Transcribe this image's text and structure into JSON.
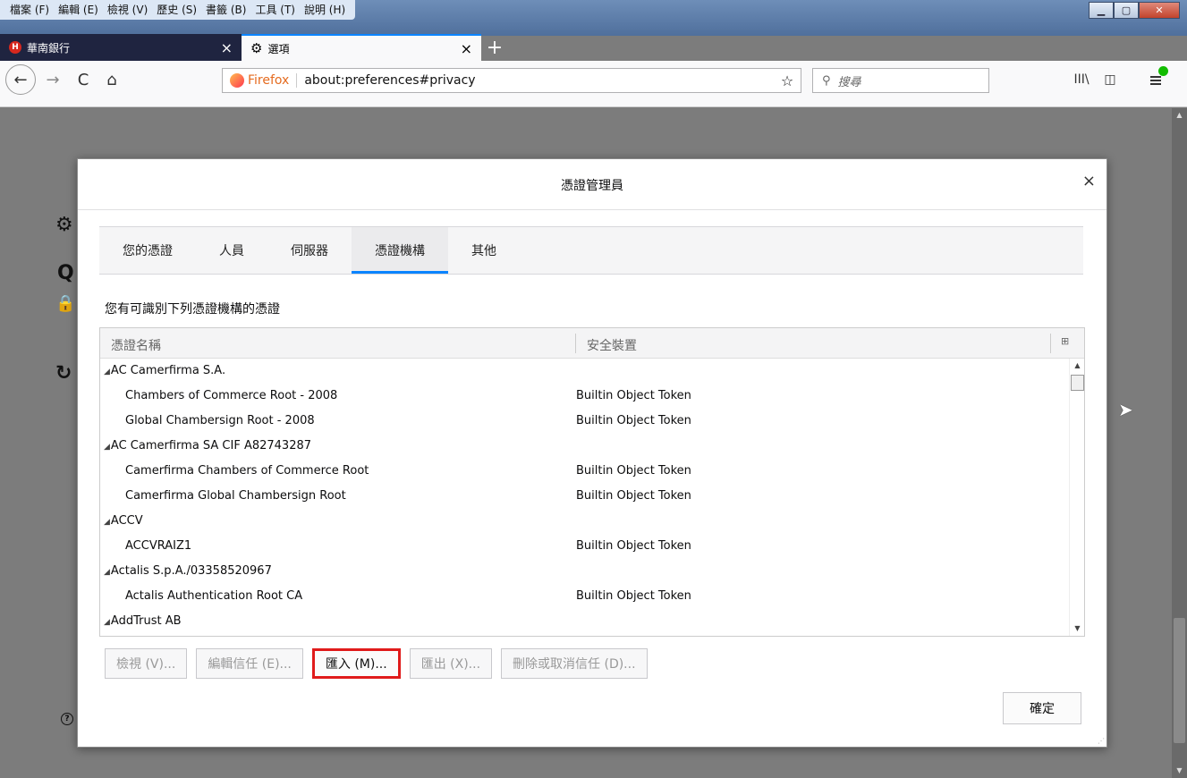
{
  "menubar": [
    "檔案 (F)",
    "編輯 (E)",
    "檢視 (V)",
    "歷史 (S)",
    "書籤 (B)",
    "工具 (T)",
    "說明 (H)"
  ],
  "tabs": {
    "inactive": {
      "label": "華南銀行",
      "close": "×"
    },
    "active": {
      "label": "選項",
      "close": "×"
    },
    "new_tab": "+"
  },
  "navbar": {
    "back": "←",
    "forward": "→",
    "reload": "C",
    "home": "⌂",
    "identity_label": "Firefox",
    "url": "about:preferences#privacy",
    "bookmark_star": "☆",
    "search_placeholder": "搜尋",
    "search_icon": "⚲",
    "library": "III\\",
    "sidebar": "◫"
  },
  "page_icons": [
    "⚙",
    "Q",
    "🔒",
    "↻"
  ],
  "dialog": {
    "title": "憑證管理員",
    "close": "×",
    "tabs": [
      "您的憑證",
      "人員",
      "伺服器",
      "憑證機構",
      "其他"
    ],
    "selected_tab": "憑證機構",
    "intro": "您有可識別下列憑證機構的憑證",
    "columns": {
      "name": "憑證名稱",
      "device": "安全裝置"
    },
    "rows": [
      {
        "name": "AC Camerfirma S.A.",
        "token": "",
        "group": true
      },
      {
        "name": "Chambers of Commerce Root - 2008",
        "token": "Builtin Object Token",
        "group": false
      },
      {
        "name": "Global Chambersign Root - 2008",
        "token": "Builtin Object Token",
        "group": false
      },
      {
        "name": "AC Camerfirma SA CIF A82743287",
        "token": "",
        "group": true
      },
      {
        "name": "Camerfirma Chambers of Commerce Root",
        "token": "Builtin Object Token",
        "group": false
      },
      {
        "name": "Camerfirma Global Chambersign Root",
        "token": "Builtin Object Token",
        "group": false
      },
      {
        "name": "ACCV",
        "token": "",
        "group": true
      },
      {
        "name": "ACCVRAIZ1",
        "token": "Builtin Object Token",
        "group": false
      },
      {
        "name": "Actalis S.p.A./03358520967",
        "token": "",
        "group": true
      },
      {
        "name": "Actalis Authentication Root CA",
        "token": "Builtin Object Token",
        "group": false
      },
      {
        "name": "AddTrust AB",
        "token": "",
        "group": true
      }
    ],
    "buttons": {
      "view": "檢視 (V)...",
      "edit_trust": "編輯信任 (E)...",
      "import": "匯入 (M)...",
      "export": "匯出 (X)...",
      "delete": "刪除或取消信任 (D)..."
    },
    "ok": "確定"
  },
  "colors": {
    "accent": "#0a84ff",
    "highlight": "#e01b1b"
  }
}
